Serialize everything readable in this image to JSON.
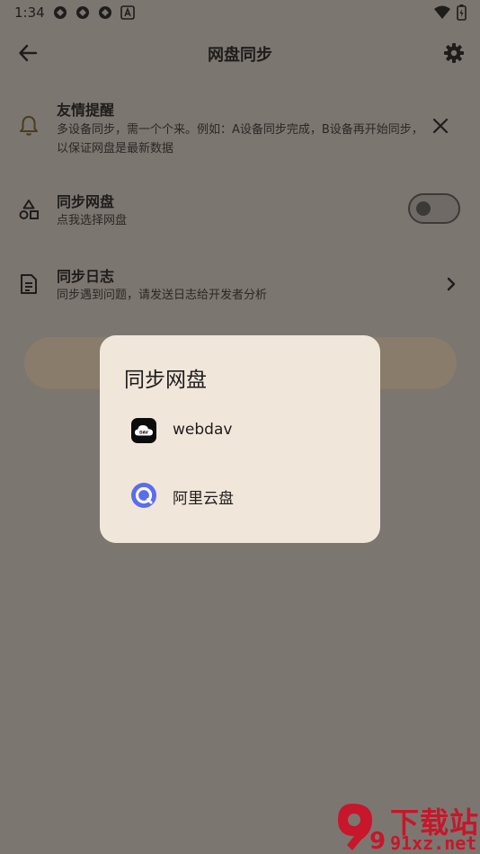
{
  "status_bar": {
    "time": "1:34"
  },
  "header": {
    "title": "网盘同步"
  },
  "rows": {
    "reminder": {
      "title": "友情提醒",
      "subtitle": "多设备同步，需一个个来。例如：A设备同步完成，B设备再开始同步，以保证网盘是最新数据"
    },
    "sync_drive": {
      "title": "同步网盘",
      "subtitle": "点我选择网盘",
      "toggle_on": false
    },
    "sync_log": {
      "title": "同步日志",
      "subtitle": "同步遇到问题，请发送日志给开发者分析"
    }
  },
  "dialog": {
    "title": "同步网盘",
    "options": [
      {
        "label": "webdav",
        "icon": "cloud-dav-icon"
      },
      {
        "label": "阿里云盘",
        "icon": "aliyun-drive-icon"
      }
    ]
  },
  "watermark": {
    "logo_text": "9",
    "text_main": "下载站",
    "text_url": "91xz.net"
  },
  "colors": {
    "scrim_background": "#7c7670",
    "dialog_background": "#f1e6da",
    "accent_button": "#897c6a",
    "aliyun_blue": "#5a6cf0",
    "watermark_red": "#c8162a"
  }
}
